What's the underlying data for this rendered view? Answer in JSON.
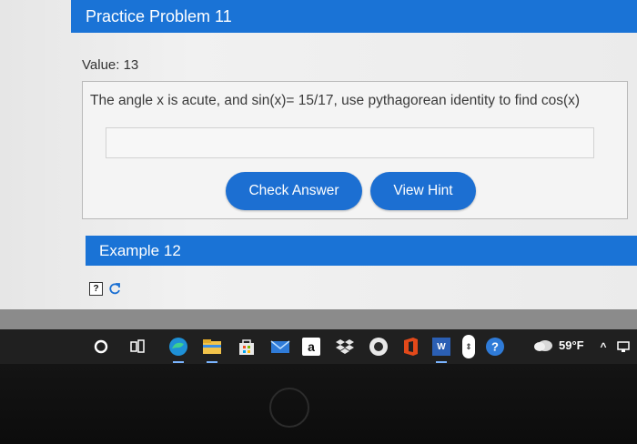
{
  "header": {
    "title": "Practice Problem 11"
  },
  "problem": {
    "value_label": "Value: 13",
    "question": "The angle x is acute, and sin(x)= 15/17, use pythagorean identity to find cos(x)",
    "answer_value": "",
    "buttons": {
      "check": "Check Answer",
      "hint": "View Hint"
    }
  },
  "example": {
    "title": "Example 12"
  },
  "taskbar": {
    "apps": [
      "search-icon",
      "task-view-icon",
      "edge-icon",
      "file-explorer-icon",
      "store-icon",
      "mail-icon",
      "amazon-icon",
      "dropbox-icon",
      "app-icon",
      "office-icon",
      "word-icon"
    ],
    "amazon_glyph": "a",
    "word_glyph": "W",
    "weather_temp": "59°F"
  },
  "colors": {
    "accent": "#1a73d6",
    "button": "#1c6fd2",
    "taskbar": "#202020"
  },
  "brand": {
    "logo": "hp"
  }
}
